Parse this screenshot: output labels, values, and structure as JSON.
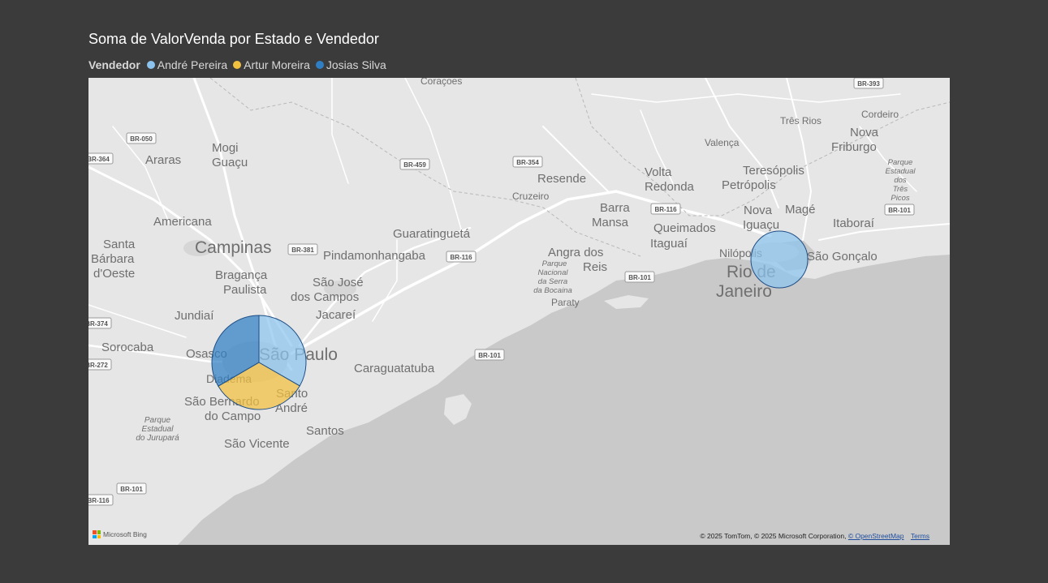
{
  "title": "Soma de ValorVenda por Estado e Vendedor",
  "legend": {
    "title": "Vendedor",
    "items": [
      {
        "label": "André Pereira",
        "color": "#8cc3ee"
      },
      {
        "label": "Artur Moreira",
        "color": "#f2c040"
      },
      {
        "label": "Josias Silva",
        "color": "#2f7ec4"
      }
    ]
  },
  "map": {
    "attribution": "© 2025 TomTom, © 2025 Microsoft Corporation,",
    "osm_link": "© OpenStreetMap",
    "terms_link": "Terms",
    "bing_logo": "Microsoft Bing",
    "place_labels": {
      "coracoes": "Coraçoes",
      "mogi_guacu_1": "Mogi",
      "mogi_guacu_2": "Guaçu",
      "araras": "Araras",
      "americana": "Americana",
      "santa_barbara_1": "Santa",
      "santa_barbara_2": "Bárbara",
      "santa_barbara_3": "d'Oeste",
      "campinas": "Campinas",
      "braganca_1": "Bragança",
      "braganca_2": "Paulista",
      "jundiai": "Jundiaí",
      "sorocaba": "Sorocaba",
      "osasco": "Osasco",
      "sao_paulo": "São Paulo",
      "diadema": "Diadema",
      "santo_andre_1": "Santo",
      "santo_andre_2": "André",
      "sbc_1": "São Bernardo",
      "sbc_2": "do Campo",
      "santos": "Santos",
      "sao_vicente": "São Vicente",
      "pq_jurupara_1": "Parque",
      "pq_jurupara_2": "Estadual",
      "pq_jurupara_3": "do Jurupará",
      "pindamonhangaba": "Pindamonhangaba",
      "guaratingueta": "Guaratinguetá",
      "sjc_1": "São José",
      "sjc_2": "dos Campos",
      "jacarei": "Jacareí",
      "caraguatatuba": "Caraguatatuba",
      "resende": "Resende",
      "cruzeiro": "Cruzeiro",
      "volta_redonda_1": "Volta",
      "volta_redonda_2": "Redonda",
      "barra_mansa_1": "Barra",
      "barra_mansa_2": "Mansa",
      "angra_1": "Angra dos",
      "angra_2": "Reis",
      "pq_bocaina_1": "Parque",
      "pq_bocaina_2": "Nacional",
      "pq_bocaina_3": "da Serra",
      "pq_bocaina_4": "da Bocaina",
      "paraty": "Paraty",
      "queimados": "Queimados",
      "itaguai": "Itaguaí",
      "valenca": "Valença",
      "tres_rios": "Três Rios",
      "teresopolis": "Teresópolis",
      "petropolis": "Petrópolis",
      "nova_iguacu_1": "Nova",
      "nova_iguacu_2": "Iguaçu",
      "mage": "Magé",
      "itaborai": "Itaboraí",
      "nilopolis": "Nilópolis",
      "rio_1": "Rio de",
      "rio_2": "Janeiro",
      "sao_goncalo": "São Gonçalo",
      "cordeiro": "Cordeiro",
      "nova_friburgo_1": "Nova",
      "nova_friburgo_2": "Friburgo",
      "pq_tres_picos_1": "Parque",
      "pq_tres_picos_2": "Estadual",
      "pq_tres_picos_3": "dos",
      "pq_tres_picos_4": "Três",
      "pq_tres_picos_5": "Picos"
    },
    "road_shields": {
      "br050": "BR-050",
      "br364": "BR-364",
      "br459": "BR-459",
      "br354": "BR-354",
      "br393": "BR-393",
      "br381": "BR-381",
      "br116a": "BR-116",
      "br116b": "BR-116",
      "br116c": "BR-116",
      "br101a": "BR-101",
      "br101b": "BR-101",
      "br101c": "BR-101",
      "br101d": "BR-101",
      "br374": "BR-374",
      "br272": "BR-272"
    }
  },
  "chart_data": {
    "type": "pie",
    "title": "Soma de ValorVenda por Estado e Vendedor",
    "legend_title": "Vendedor",
    "series_names": [
      "André Pereira",
      "Artur Moreira",
      "Josias Silva"
    ],
    "locations": [
      {
        "location": "São Paulo",
        "slices": [
          {
            "name": "André Pereira",
            "share": 0.333
          },
          {
            "name": "Artur Moreira",
            "share": 0.333
          },
          {
            "name": "Josias Silva",
            "share": 0.334
          }
        ]
      },
      {
        "location": "Rio de Janeiro",
        "slices": [
          {
            "name": "André Pereira",
            "share": 1.0
          }
        ]
      }
    ]
  }
}
